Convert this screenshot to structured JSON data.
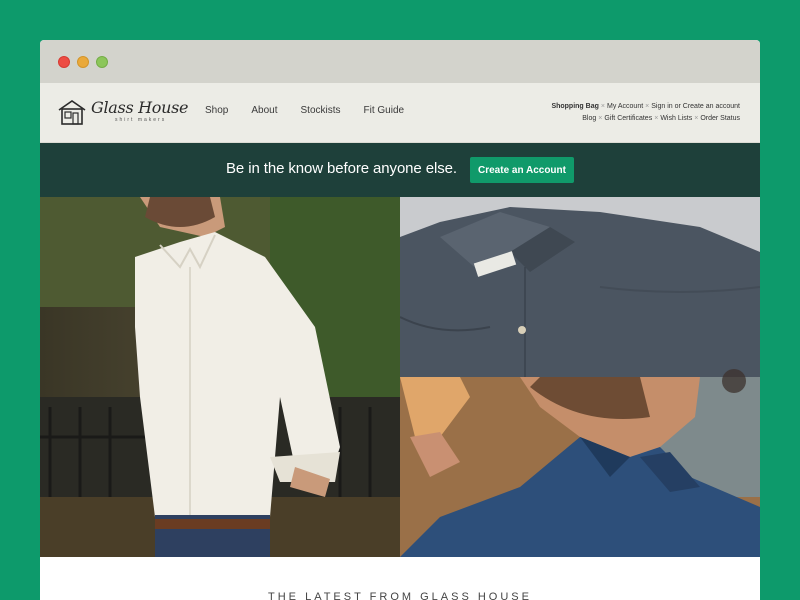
{
  "window": {
    "controls": [
      "close",
      "minimize",
      "zoom"
    ]
  },
  "brand": {
    "name": "Glass House",
    "tagline": "shirt makers",
    "logo_icon": "house-icon"
  },
  "nav": {
    "items": [
      "Shop",
      "About",
      "Stockists",
      "Fit Guide"
    ]
  },
  "utility": {
    "row1": {
      "shopping_bag": "Shopping Bag",
      "my_account": "My Account",
      "sign_in": "Sign in or Create an account"
    },
    "row2": {
      "blog": "Blog",
      "gift_certificates": "Gift Certificates",
      "wish_lists": "Wish Lists",
      "order_status": "Order Status"
    },
    "separator": "×"
  },
  "banner": {
    "text": "Be in the know before anyone else.",
    "button_label": "Create an Account"
  },
  "photos": [
    {
      "subject": "man in white shirt"
    },
    {
      "subject": "folded chambray shirt"
    },
    {
      "subject": "man in blue shirt"
    }
  ],
  "section": {
    "heading": "THE LATEST FROM GLASS HOUSE"
  },
  "colors": {
    "page_background": "#0d9a6b",
    "banner_background": "#1e403a",
    "button_background": "#109a6a",
    "header_background": "#ecece6"
  }
}
